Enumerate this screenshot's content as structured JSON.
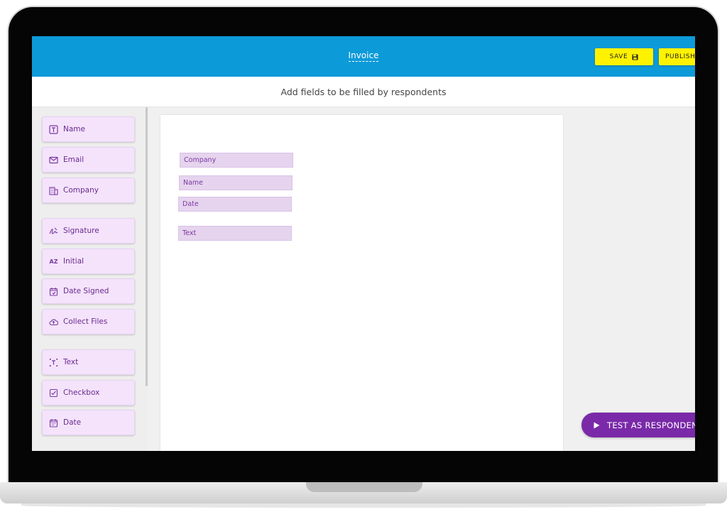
{
  "header": {
    "document_title": "Invoice",
    "save_label": "SAVE",
    "publish_label": "PUBLISH"
  },
  "subheader": {
    "instruction": "Add fields to be filled by respondents"
  },
  "sidebar": {
    "items": [
      {
        "label": "Name",
        "icon": "text-box-icon"
      },
      {
        "label": "Email",
        "icon": "envelope-icon"
      },
      {
        "label": "Company",
        "icon": "building-icon"
      },
      {
        "label": "Signature",
        "icon": "signature-icon"
      },
      {
        "label": "Initial",
        "icon": "initials-icon"
      },
      {
        "label": "Date Signed",
        "icon": "calendar-signed-icon"
      },
      {
        "label": "Collect Files",
        "icon": "cloud-upload-icon"
      },
      {
        "label": "Text",
        "icon": "text-cursor-icon"
      },
      {
        "label": "Checkbox",
        "icon": "checkbox-icon"
      },
      {
        "label": "Date",
        "icon": "calendar-icon"
      }
    ]
  },
  "document": {
    "placed_fields": [
      {
        "label": "Company"
      },
      {
        "label": "Name"
      },
      {
        "label": "Date"
      },
      {
        "label": "Text"
      }
    ]
  },
  "actions": {
    "test_label": "TEST AS RESPONDENT"
  },
  "colors": {
    "topbar": "#0d9ad9",
    "accent_yellow": "#fff200",
    "field_purple": "#7a3aa0",
    "field_bg": "#f4e3fb",
    "test_button": "#7a2aa8"
  }
}
